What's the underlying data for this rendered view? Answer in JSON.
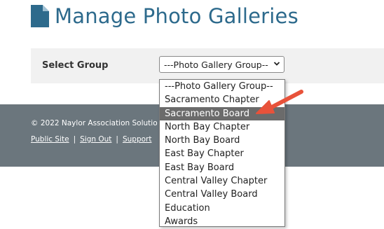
{
  "page": {
    "title": "Manage Photo Galleries",
    "icon": "document-icon",
    "accent_color": "#2d6a8c"
  },
  "form": {
    "select_label": "Select Group",
    "select_value": "---Photo Gallery Group--"
  },
  "dropdown": {
    "highlighted_index": 2,
    "options": [
      "---Photo Gallery Group--",
      "Sacramento Chapter",
      "Sacramento Board",
      "North Bay Chapter",
      "North Bay Board",
      "East Bay Chapter",
      "East Bay Board",
      "Central Valley Chapter",
      "Central Valley Board",
      "Education",
      "Awards"
    ]
  },
  "footer": {
    "copyright": "© 2022 Naylor Association Solutio",
    "links": [
      "Public Site",
      "Sign Out",
      "Support"
    ],
    "separator": "|",
    "background_color": "#6b767d"
  },
  "annotation": {
    "arrow_color": "#e8523a",
    "points_to": "Sacramento Board"
  }
}
